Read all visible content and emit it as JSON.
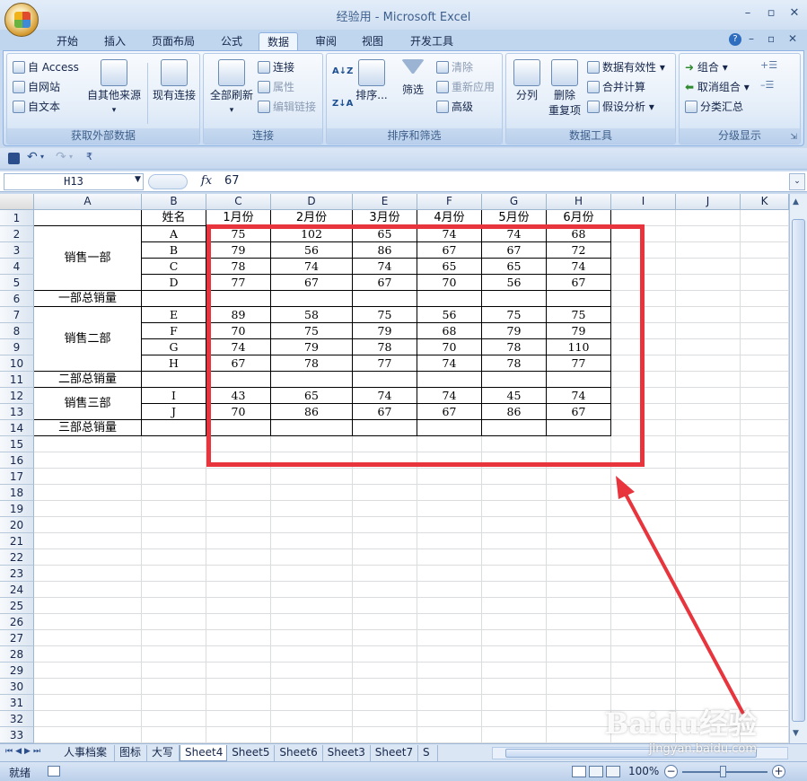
{
  "window": {
    "title": "经验用 - Microsoft Excel"
  },
  "tabs": [
    "开始",
    "插入",
    "页面布局",
    "公式",
    "数据",
    "审阅",
    "视图",
    "开发工具"
  ],
  "active_tab": "数据",
  "ribbon": {
    "get_external": {
      "access": "自 Access",
      "web": "自网站",
      "text": "自文本",
      "other": "自其他来源",
      "existing": "现有连接",
      "label": "获取外部数据"
    },
    "connections": {
      "refresh_all": "全部刷新",
      "connections": "连接",
      "properties": "属性",
      "edit_links": "编辑链接",
      "label": "连接"
    },
    "sort_filter": {
      "sort": "排序...",
      "filter": "筛选",
      "clear": "清除",
      "reapply": "重新应用",
      "advanced": "高级",
      "label": "排序和筛选",
      "sort_az": "A↓Z",
      "sort_za": "Z↓A"
    },
    "data_tools": {
      "split": "分列",
      "remove_dup_1": "删除",
      "remove_dup_2": "重复项",
      "validation": "数据有效性",
      "consolidate": "合并计算",
      "what_if": "假设分析",
      "label": "数据工具"
    },
    "outline": {
      "group": "组合",
      "ungroup": "取消组合",
      "subtotal": "分类汇总",
      "label": "分级显示"
    }
  },
  "formula_bar": {
    "name_box": "H13",
    "fx": "fx",
    "value": "67"
  },
  "sheet": {
    "columns": [
      "A",
      "B",
      "C",
      "D",
      "E",
      "F",
      "G",
      "H",
      "I",
      "J",
      "K"
    ],
    "row_numbers": [
      "1",
      "2",
      "3",
      "4",
      "5",
      "6",
      "7",
      "8",
      "9",
      "10",
      "11",
      "12",
      "13",
      "14",
      "15",
      "16",
      "17",
      "18",
      "19",
      "20",
      "21",
      "22",
      "23",
      "24",
      "25",
      "26",
      "27",
      "28",
      "29",
      "30",
      "31",
      "32",
      "33"
    ],
    "header_row": [
      "姓名",
      "1月份",
      "2月份",
      "3月份",
      "4月份",
      "5月份",
      "6月份"
    ],
    "dept1": "销售一部",
    "dept2": "销售二部",
    "dept3": "销售三部",
    "total1": "一部总销量",
    "total2": "二部总销量",
    "total3": "三部总销量",
    "data_rows": [
      [
        "A",
        "75",
        "102",
        "65",
        "74",
        "74",
        "68"
      ],
      [
        "B",
        "79",
        "56",
        "86",
        "67",
        "67",
        "72"
      ],
      [
        "C",
        "78",
        "74",
        "74",
        "65",
        "65",
        "74"
      ],
      [
        "D",
        "77",
        "67",
        "67",
        "70",
        "56",
        "67"
      ],
      [
        "E",
        "89",
        "58",
        "75",
        "56",
        "75",
        "75"
      ],
      [
        "F",
        "70",
        "75",
        "79",
        "68",
        "79",
        "79"
      ],
      [
        "G",
        "74",
        "79",
        "78",
        "70",
        "78",
        "110"
      ],
      [
        "H",
        "67",
        "78",
        "77",
        "74",
        "78",
        "77"
      ],
      [
        "I",
        "43",
        "65",
        "74",
        "74",
        "45",
        "74"
      ],
      [
        "J",
        "70",
        "86",
        "67",
        "67",
        "86",
        "67"
      ]
    ]
  },
  "sheet_tabs": [
    "人事档案",
    "图标",
    "大写",
    "Sheet4",
    "Sheet5",
    "Sheet6",
    "Sheet3",
    "Sheet7",
    "S"
  ],
  "active_sheet": "Sheet4",
  "status": {
    "ready": "就绪",
    "zoom": "100%"
  },
  "watermark": {
    "brand": "Baidu经验",
    "url": "jingyan.baidu.com"
  },
  "colors": {
    "annotation_red": "#e8343c",
    "ribbon_bg": "#dde9f7"
  }
}
